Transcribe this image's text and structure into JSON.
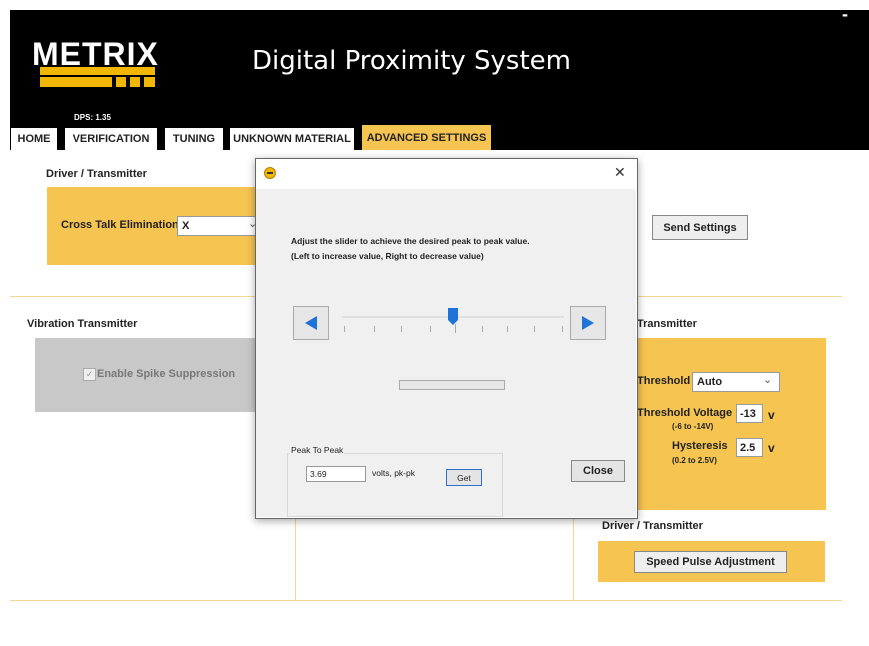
{
  "header": {
    "logo": "METRIX",
    "version": "DPS: 1.35",
    "title": "Digital Proximity System",
    "minimize": "-"
  },
  "tabs": [
    {
      "label": "HOME"
    },
    {
      "label": "VERIFICATION"
    },
    {
      "label": "TUNING"
    },
    {
      "label": "UNKNOWN MATERIAL"
    },
    {
      "label": "ADVANCED SETTINGS"
    }
  ],
  "driver_section": {
    "title": "Driver / Transmitter",
    "cross_talk_label": "Cross Talk Elimination",
    "cross_talk_value": "X",
    "chevron": "⌄",
    "send_button": "Send Settings"
  },
  "vibration_section": {
    "title": "Vibration Transmitter",
    "checkbox_label": "Enable Spike Suppression",
    "checkbox_checked": true
  },
  "right_section": {
    "title_partial": "Transmitter",
    "threshold_label": "Threshold",
    "threshold_value": "Auto",
    "threshold_voltage_label": "Threshold Voltage",
    "threshold_voltage_range": "(-6 to -14V)",
    "threshold_voltage_value": "-13",
    "threshold_voltage_unit": "v",
    "hysteresis_label": "Hysteresis",
    "hysteresis_range": "(0.2 to 2.5V)",
    "hysteresis_value": "2.5",
    "hysteresis_unit": "v"
  },
  "driver_bottom": {
    "title": "Driver / Transmitter",
    "speed_button": "Speed Pulse Adjustment"
  },
  "dialog": {
    "close_x": "✕",
    "instruction_line1": "Adjust the slider to achieve the desired peak to peak value.",
    "instruction_line2": "(Left to increase value, Right to decrease value)",
    "slider_value_fraction": 0.5,
    "peak_group_label": "Peak To Peak",
    "peak_value": "3.69",
    "peak_unit": "volts, pk-pk",
    "get_button": "Get",
    "close_button": "Close"
  },
  "colors": {
    "accent": "#f5c451",
    "header_bg": "#000000",
    "arrow_blue": "#1e73d8"
  }
}
